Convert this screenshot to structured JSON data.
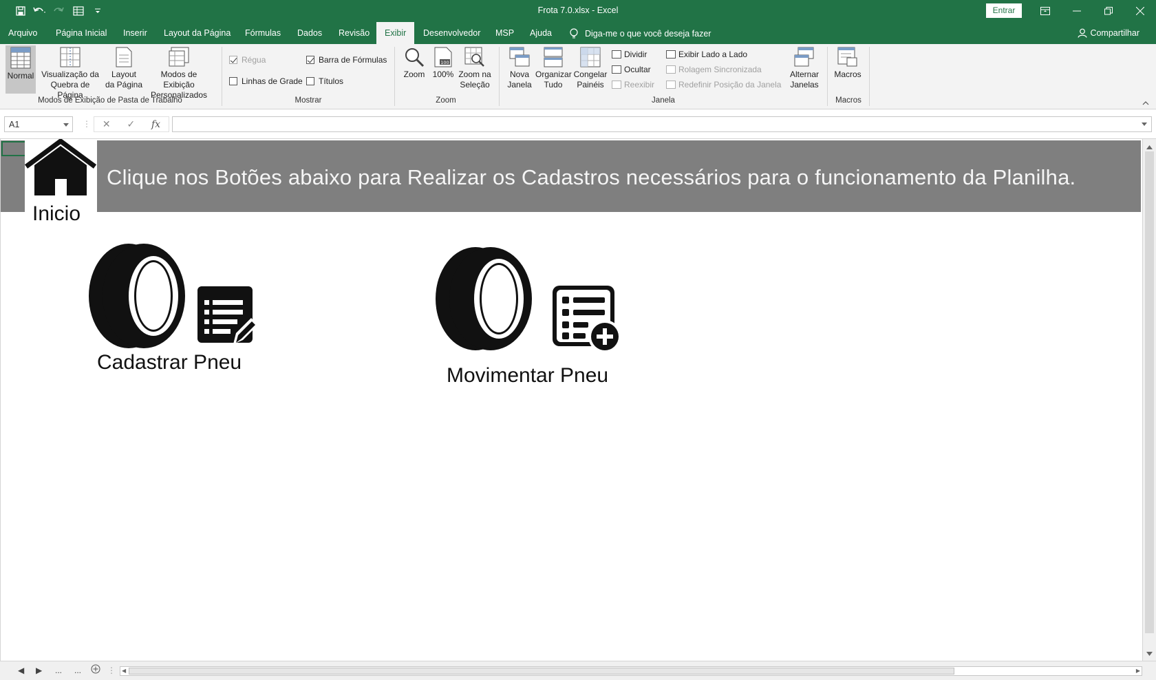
{
  "window": {
    "title": "Frota 7.0.xlsx  -  Excel",
    "signin_label": "Entrar"
  },
  "menu": {
    "tabs": [
      "Arquivo",
      "Página Inicial",
      "Inserir",
      "Layout da Página",
      "Fórmulas",
      "Dados",
      "Revisão",
      "Exibir",
      "Desenvolvedor",
      "MSP",
      "Ajuda"
    ],
    "active_tab": "Exibir",
    "tellme": "Diga-me o que você deseja fazer",
    "share": "Compartilhar"
  },
  "ribbon": {
    "views": {
      "normal": "Normal",
      "page_break_1": "Visualização da",
      "page_break_2": "Quebra de Página",
      "page_layout_1": "Layout",
      "page_layout_2": "da Página",
      "custom_1": "Modos de Exibição",
      "custom_2": "Personalizados",
      "group": "Modos de Exibição de Pasta de Trabalho"
    },
    "show": {
      "ruler": "Régua",
      "formula_bar": "Barra de Fórmulas",
      "gridlines": "Linhas de Grade",
      "headings": "Títulos",
      "group": "Mostrar"
    },
    "zoom": {
      "zoom": "Zoom",
      "hundred": "100%",
      "selection_1": "Zoom na",
      "selection_2": "Seleção",
      "group": "Zoom"
    },
    "window": {
      "new_1": "Nova",
      "new_2": "Janela",
      "arrange_1": "Organizar",
      "arrange_2": "Tudo",
      "freeze_1": "Congelar",
      "freeze_2": "Painéis",
      "split": "Dividir",
      "hide": "Ocultar",
      "unhide": "Reexibir",
      "side_by_side": "Exibir Lado a Lado",
      "sync_scroll": "Rolagem Sincronizada",
      "reset_pos": "Redefinir Posição da Janela",
      "switch_1": "Alternar",
      "switch_2": "Janelas",
      "group": "Janela"
    },
    "macros": {
      "macros": "Macros",
      "group": "Macros"
    }
  },
  "formula_bar": {
    "name_box": "A1",
    "fx": "fx",
    "value": ""
  },
  "sheet": {
    "banner": "Clique nos Botões abaixo para Realizar os Cadastros necessários para o funcionamento da Planilha.",
    "home_label": "Inicio",
    "buttons": {
      "register": "Cadastrar Pneu",
      "move": "Movimentar Pneu"
    },
    "colors": {
      "banner_bg": "#7f7f7f",
      "excel_green": "#217346"
    }
  },
  "bottom": {
    "ellipsis_1": "...",
    "ellipsis_2": "..."
  }
}
